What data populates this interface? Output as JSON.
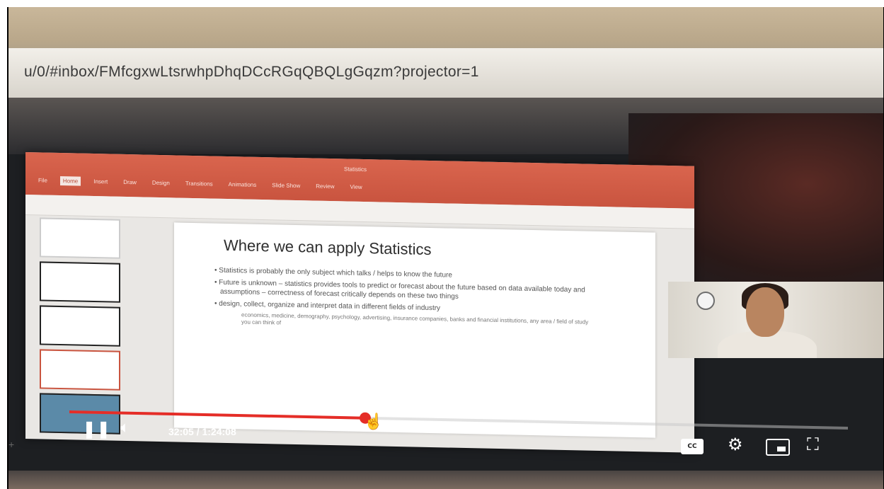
{
  "browser": {
    "address": "u/0/#inbox/FMfcgxwLtsrwhpDhqDCcRGqQBQLgGqzm?projector=1"
  },
  "powerpoint": {
    "tabs": [
      "File",
      "Home",
      "Insert",
      "Draw",
      "Design",
      "Transitions",
      "Animations",
      "Slide Show",
      "Review",
      "View"
    ],
    "active_tab": "Home",
    "title": "Statistics"
  },
  "slide": {
    "title": "Where we can apply Statistics",
    "bullets": [
      "Statistics is probably the only subject which talks / helps to know the future",
      "Future is unknown – statistics provides tools to predict or forecast about the future based on data available today and assumptions – correctness of forecast critically depends on these two things",
      "design, collect, organize and interpret data in different fields of industry"
    ],
    "sub_bullet": "economics, medicine, demography, psychology, advertising, insurance companies, banks and financial institutions, any area / field of study you can think of"
  },
  "player": {
    "time": "32:05 / 1:24:08",
    "progress": 0.38,
    "cc_label": "CC"
  },
  "icons": {
    "pause": "pause-icon",
    "volume": "volume-icon",
    "settings": "gear-icon",
    "miniplayer": "miniplayer-icon",
    "fullscreen": "fullscreen-icon"
  },
  "colors": {
    "accent": "#e52d27",
    "ribbon": "#c9543f"
  }
}
